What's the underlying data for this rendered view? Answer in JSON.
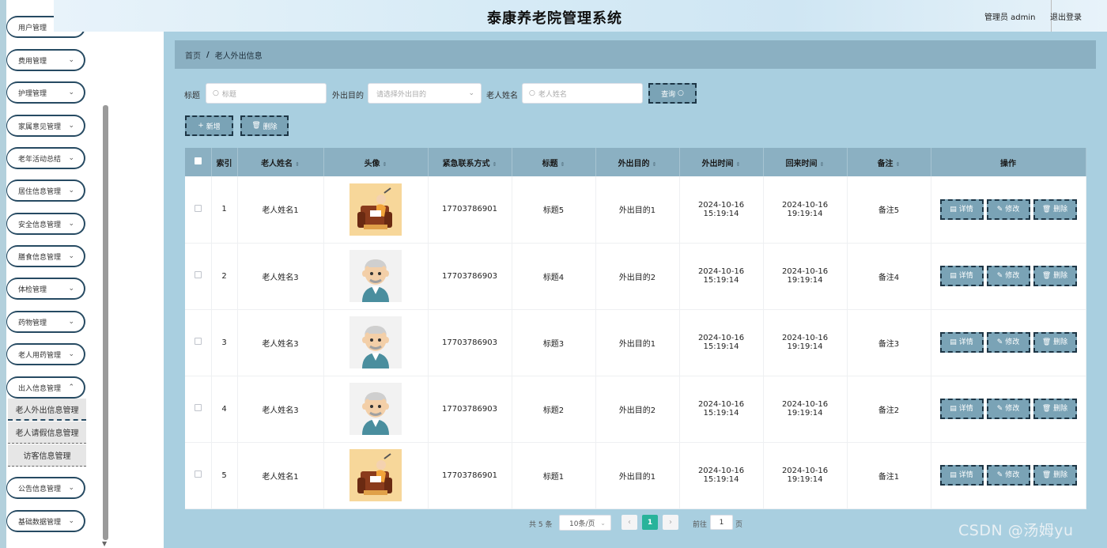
{
  "header": {
    "title": "泰康养老院管理系统",
    "user": "管理员 admin",
    "logout": "退出登录"
  },
  "sidebar": {
    "items": [
      {
        "label": "用户管理"
      },
      {
        "label": "费用管理"
      },
      {
        "label": "护理管理"
      },
      {
        "label": "家属意见管理"
      },
      {
        "label": "老年活动总结"
      },
      {
        "label": "居住信息管理"
      },
      {
        "label": "安全信息管理"
      },
      {
        "label": "膳食信息管理"
      },
      {
        "label": "体检管理"
      },
      {
        "label": "药物管理"
      },
      {
        "label": "老人用药管理"
      },
      {
        "label": "出入信息管理"
      },
      {
        "label": "公告信息管理"
      },
      {
        "label": "基础数据管理"
      }
    ],
    "sub_items": [
      {
        "label": "老人外出信息管理"
      },
      {
        "label": "老人请假信息管理"
      },
      {
        "label": "访客信息管理"
      }
    ]
  },
  "breadcrumb": {
    "home": "首页",
    "sep": "/",
    "current": "老人外出信息"
  },
  "search": {
    "title_label": "标题",
    "title_placeholder": "标题",
    "purpose_label": "外出目的",
    "purpose_placeholder": "请选择外出目的",
    "name_label": "老人姓名",
    "name_placeholder": "老人姓名",
    "query_button": "查询"
  },
  "actions": {
    "add": "新增",
    "delete": "删除"
  },
  "table": {
    "headers": [
      "索引",
      "老人姓名",
      "头像",
      "紧急联系方式",
      "标题",
      "外出目的",
      "外出时间",
      "回来时间",
      "备注",
      "操作"
    ],
    "rows": [
      {
        "index": "1",
        "name": "老人姓名1",
        "avatar": "armchair-elder",
        "phone": "17703786901",
        "title": "标题5",
        "purpose": "外出目的1",
        "out_time": "2024-10-16 15:19:14",
        "back_time": "2024-10-16 19:19:14",
        "note": "备注5"
      },
      {
        "index": "2",
        "name": "老人姓名3",
        "avatar": "elder-man",
        "phone": "17703786903",
        "title": "标题4",
        "purpose": "外出目的2",
        "out_time": "2024-10-16 15:19:14",
        "back_time": "2024-10-16 19:19:14",
        "note": "备注4"
      },
      {
        "index": "3",
        "name": "老人姓名3",
        "avatar": "elder-man",
        "phone": "17703786903",
        "title": "标题3",
        "purpose": "外出目的1",
        "out_time": "2024-10-16 15:19:14",
        "back_time": "2024-10-16 19:19:14",
        "note": "备注3"
      },
      {
        "index": "4",
        "name": "老人姓名3",
        "avatar": "elder-man",
        "phone": "17703786903",
        "title": "标题2",
        "purpose": "外出目的2",
        "out_time": "2024-10-16 15:19:14",
        "back_time": "2024-10-16 19:19:14",
        "note": "备注2"
      },
      {
        "index": "5",
        "name": "老人姓名1",
        "avatar": "armchair-elder",
        "phone": "17703786901",
        "title": "标题1",
        "purpose": "外出目的1",
        "out_time": "2024-10-16 15:19:14",
        "back_time": "2024-10-16 19:19:14",
        "note": "备注1"
      }
    ],
    "row_actions": {
      "detail": "详情",
      "edit": "修改",
      "delete": "删除"
    }
  },
  "pagination": {
    "total": "共 5 条",
    "page_size": "10条/页",
    "current_page": "1",
    "goto_label": "前往",
    "goto_value": "1",
    "page_suffix": "页"
  },
  "watermark": "CSDN @汤姆yu",
  "colors": {
    "accent": "#7aa3b6",
    "header_bg": "#8bb0c2",
    "active_page": "#28b39a",
    "border_dark": "#1d3646"
  }
}
